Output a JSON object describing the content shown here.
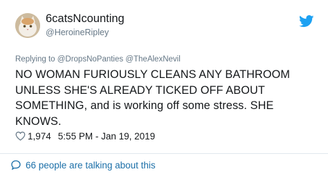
{
  "user": {
    "display_name": "6catsNcounting",
    "handle": "@HeroineRipley"
  },
  "tweet": {
    "reply_to": "Replying to @DropsNoPanties @TheAlexNevil",
    "text": "NO WOMAN FURIOUSLY CLEANS ANY BATHROOM UNLESS SHE'S ALREADY TICKED OFF ABOUT SOMETHING,  and is working off some stress.  SHE KNOWS.",
    "likes": "1,974",
    "timestamp": "5:55 PM - Jan 19, 2019"
  },
  "footer": {
    "talking_label": "66 people are talking about this"
  },
  "colors": {
    "twitter_blue": "#1da1f2",
    "link_blue": "#1b6fa8",
    "muted": "#657786"
  },
  "icons": [
    "avatar-cat",
    "twitter-bird-icon",
    "heart-icon",
    "speech-bubble-icon"
  ]
}
